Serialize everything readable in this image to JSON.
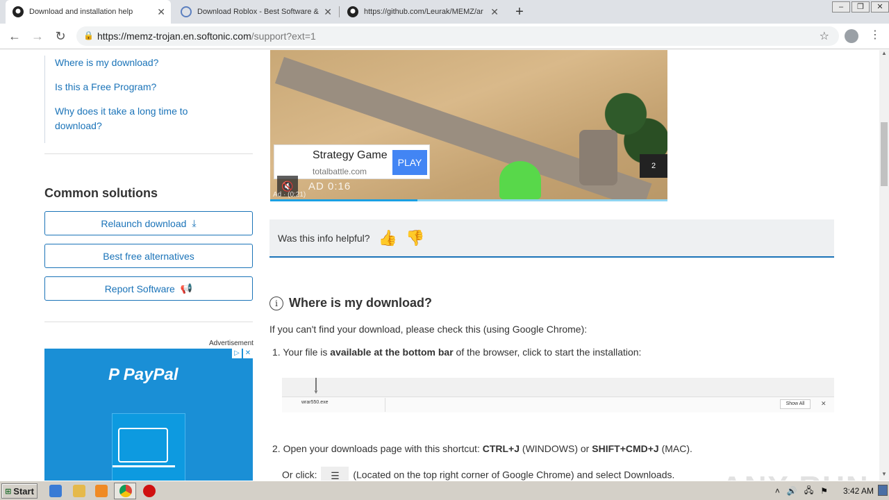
{
  "tabs": [
    {
      "title": "Download and installation help",
      "icon": "github-icon",
      "active": true
    },
    {
      "title": "Download Roblox - Best Software &",
      "icon": "softonic-icon",
      "active": false
    },
    {
      "title": "https://github.com/Leurak/MEMZ/ar",
      "icon": "github-icon",
      "active": false
    }
  ],
  "new_tab": "+",
  "window_controls": [
    "–",
    "❐",
    "✕"
  ],
  "address": {
    "host": "https://memz-trojan.en.softonic.com",
    "path": "/support?ext=1"
  },
  "sidebar": {
    "faq_links": [
      {
        "label": "Where is my download?"
      },
      {
        "label": "Is this a Free Program?"
      },
      {
        "label": "Why does it take a long time to download?"
      }
    ],
    "common_title": "Common solutions",
    "buttons": [
      {
        "label": "Relaunch download",
        "icon": "download-icon"
      },
      {
        "label": "Best free alternatives"
      },
      {
        "label": "Report Software",
        "icon": "megaphone-icon"
      }
    ],
    "ad_label": "Advertisement",
    "paypal_logo": "PayPal"
  },
  "video_ad": {
    "game_title": "Strategy Game",
    "site": "totalbattle.com",
    "play_label": "PLAY",
    "timer": "AD  0:16",
    "count": "Ad · (0:21)",
    "skip_count": "2",
    "progress_fraction": 0.37
  },
  "helpful": {
    "question": "Was this info helpful?"
  },
  "article": {
    "heading": "Where is my download?",
    "intro": "If you can't find your download, please check this (using Google Chrome):",
    "step1_prefix": "1. Your file is ",
    "step1_bold": "available at the bottom bar",
    "step1_suffix": " of the browser, click to start the installation:",
    "dl_file": "wrar550.exe",
    "dl_show_all": "Show All",
    "step2_prefix": "2. Open your downloads page with this shortcut: ",
    "step2_key1": "CTRL+J",
    "step2_mid": " (WINDOWS) or ",
    "step2_key2": "SHIFT+CMD+J",
    "step2_suffix": " (MAC).",
    "step2b_prefix": "Or click:",
    "step2b_suffix": "(Located on the top right corner of Google Chrome) and select Downloads."
  },
  "watermark": "ANY RUN",
  "taskbar": {
    "start": "Start",
    "clock": "3:42 AM"
  }
}
